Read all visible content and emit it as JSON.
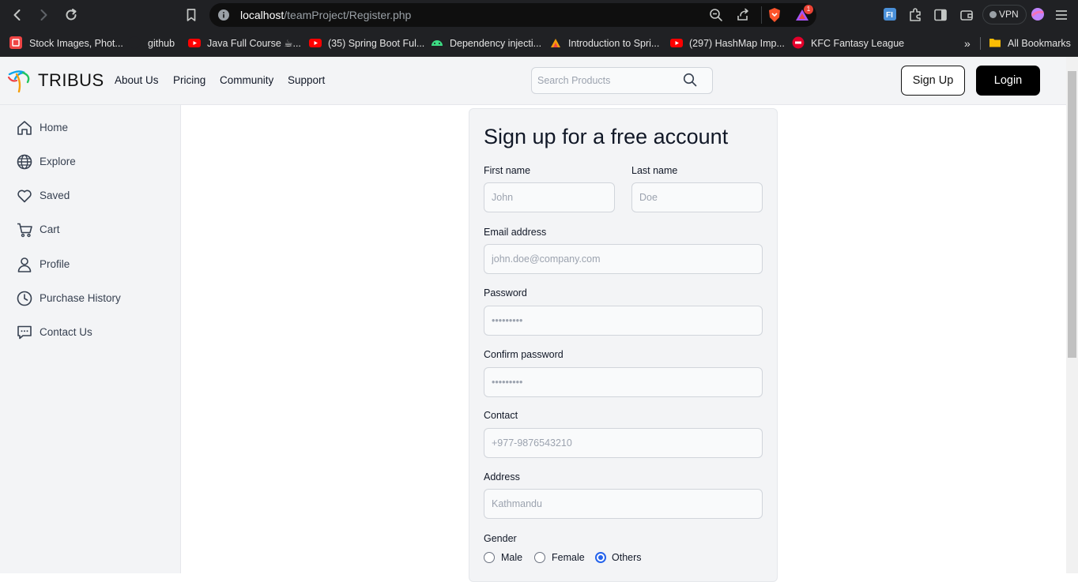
{
  "browser": {
    "url_host": "localhost",
    "url_path": "/teamProject/Register.php",
    "vpn_label": "VPN",
    "notification_count": "1",
    "bookmarks": [
      {
        "label": "Stock Images, Phot...",
        "icon": "image-stock-icon",
        "color": "#ef4444"
      },
      {
        "label": "github",
        "icon": "github-icon",
        "color": "#202124"
      },
      {
        "label": "Java Full Course ☕...",
        "icon": "youtube-icon",
        "color": "#ff0000"
      },
      {
        "label": "(35) Spring Boot Ful...",
        "icon": "youtube-icon",
        "color": "#ff0000"
      },
      {
        "label": "Dependency injecti...",
        "icon": "android-icon",
        "color": "#3ddc84"
      },
      {
        "label": "Introduction to Spri...",
        "icon": "triangle-logo-icon",
        "color": "#f59e0b"
      },
      {
        "label": "(297) HashMap Imp...",
        "icon": "youtube-icon",
        "color": "#ff0000"
      },
      {
        "label": "KFC Fantasy League",
        "icon": "kfc-icon",
        "color": "#e4002b"
      }
    ],
    "all_bookmarks_label": "All Bookmarks"
  },
  "header": {
    "logo": "TRIBUS",
    "nav": [
      "About Us",
      "Pricing",
      "Community",
      "Support"
    ],
    "search_placeholder": "Search Products",
    "signup_label": "Sign Up",
    "login_label": "Login"
  },
  "sidebar": {
    "items": [
      {
        "label": "Home",
        "icon": "home-icon"
      },
      {
        "label": "Explore",
        "icon": "globe-icon"
      },
      {
        "label": "Saved",
        "icon": "heart-icon"
      },
      {
        "label": "Cart",
        "icon": "cart-icon"
      },
      {
        "label": "Profile",
        "icon": "user-icon"
      },
      {
        "label": "Purchase History",
        "icon": "clock-icon"
      },
      {
        "label": "Contact Us",
        "icon": "chat-icon"
      }
    ]
  },
  "form": {
    "title": "Sign up for a free account",
    "first_name_label": "First name",
    "first_name_placeholder": "John",
    "last_name_label": "Last name",
    "last_name_placeholder": "Doe",
    "email_label": "Email address",
    "email_placeholder": "john.doe@company.com",
    "password_label": "Password",
    "password_placeholder": "•••••••••",
    "confirm_label": "Confirm password",
    "confirm_placeholder": "•••••••••",
    "contact_label": "Contact",
    "contact_placeholder": "+977-9876543210",
    "address_label": "Address",
    "address_placeholder": "Kathmandu",
    "gender_label": "Gender",
    "gender_options": [
      "Male",
      "Female",
      "Others"
    ],
    "gender_selected": "Others"
  },
  "colors": {
    "chrome_bg": "#202124",
    "header_bg": "#f3f4f6",
    "login_bg": "#000000",
    "radio_accent": "#2563eb"
  }
}
